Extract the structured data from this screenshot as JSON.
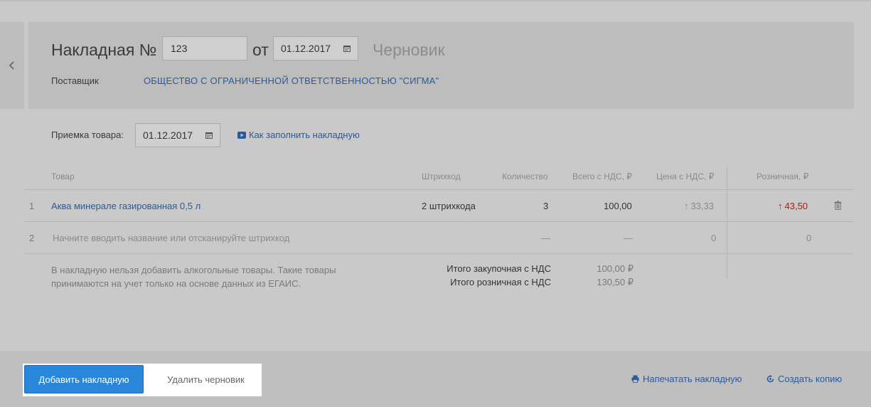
{
  "header": {
    "title": "Накладная №",
    "number_value": "123",
    "from_label": "от",
    "date_value": "01.12.2017",
    "status": "Черновик",
    "supplier_label": "Поставщик",
    "supplier_name": "ОБЩЕСТВО С ОГРАНИЧЕННОЙ ОТВЕТСТВЕННОСТЬЮ \"СИГМА\""
  },
  "receipt": {
    "label": "Приемка товара:",
    "date_value": "01.12.2017",
    "howto_link": "Как заполнить накладную"
  },
  "table": {
    "headers": {
      "product": "Товар",
      "barcode": "Штрихкод",
      "quantity": "Количество",
      "total_vat": "Всего с НДС, ₽",
      "price_vat": "Цена с НДС, ₽",
      "retail": "Розничная, ₽"
    },
    "rows": [
      {
        "num": "1",
        "product": "Аква минерале газированная 0,5 л",
        "barcode": "2 штрихкода",
        "quantity": "3",
        "total": "100,00",
        "price": "33,33",
        "retail": "43,50"
      },
      {
        "num": "2",
        "product_placeholder": "Начните вводить название или отсканируйте штрихкод",
        "quantity": "—",
        "total": "—",
        "price": "0",
        "retail": "0"
      }
    ],
    "note": "В накладную нельзя добавить алкогольные товары. Такие товары принимаются на учет только на основе данных из ЕГАИС.",
    "totals": {
      "purchase_label": "Итого закупочная с НДС",
      "purchase_value": "100,00 ₽",
      "retail_label": "Итого розничная с НДС",
      "retail_value": "130,50 ₽"
    }
  },
  "footer": {
    "add_button": "Добавить накладную",
    "delete_button": "Удалить черновик",
    "print_link": "Напечатать накладную",
    "copy_link": "Создать копию"
  },
  "colors": {
    "link": "#2a5a9c",
    "primary": "#2a86d8",
    "retail_up": "#a02020"
  }
}
